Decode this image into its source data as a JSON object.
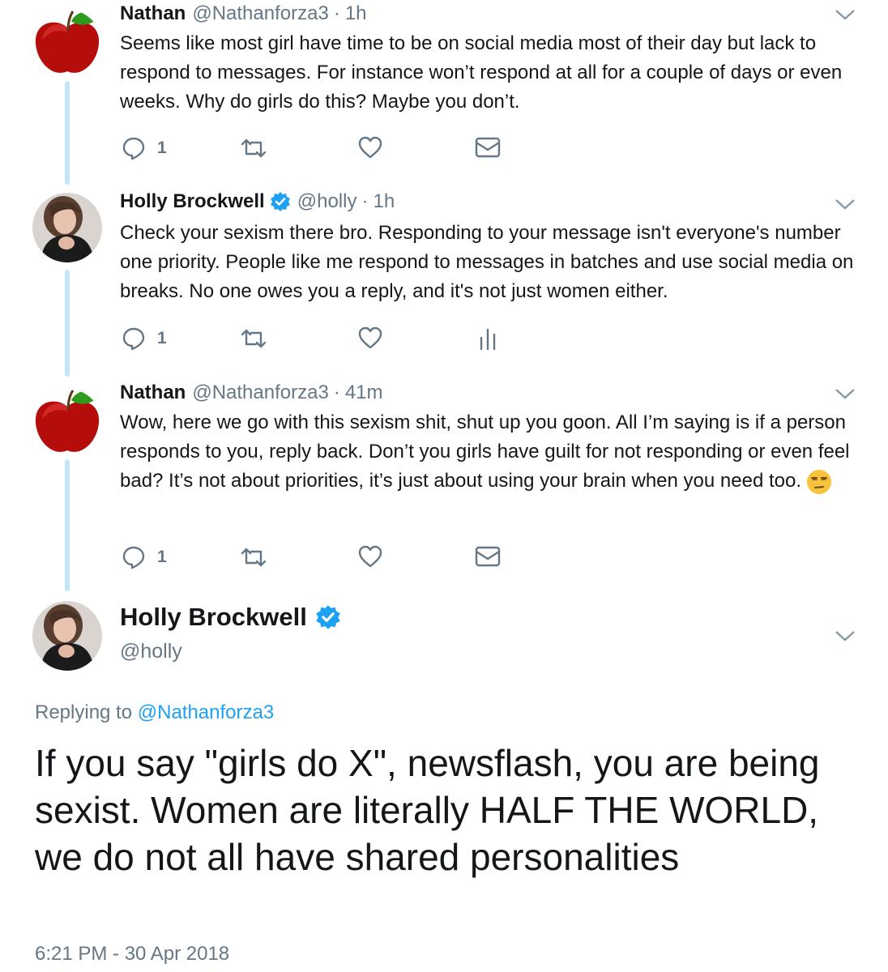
{
  "thread": [
    {
      "author": "Nathan",
      "handle": "@Nathanforza3",
      "time": "1h",
      "avatar_icon": "apple-icon",
      "verified": false,
      "text": "Seems like most girl have time to be on social media most of their day but lack to respond to messages. For instance won’t respond at all for a couple of days or even weeks. Why do girls do this? Maybe you don’t.",
      "reply_count": "1",
      "last_action_icon": "dm-envelope-icon"
    },
    {
      "author": "Holly Brockwell",
      "handle": "@holly",
      "time": "1h",
      "avatar_icon": "profile-photo",
      "verified": true,
      "text": "Check your sexism there bro. Responding to your message isn't everyone's number one priority. People like me respond to messages in batches and use social media on breaks. No one owes you a reply, and it's not just women either.",
      "reply_count": "1",
      "last_action_icon": "analytics-icon"
    },
    {
      "author": "Nathan",
      "handle": "@Nathanforza3",
      "time": "41m",
      "avatar_icon": "apple-icon",
      "verified": false,
      "text": "Wow, here we go with this sexism shit, shut up you goon. All I’m saying is if a person responds to you, reply back. Don’t you girls have guilt for not responding or even feel bad? It’s not about priorities, it’s just about using your brain when you need too.",
      "emoji": "unamused-face-emoji",
      "reply_count": "1",
      "last_action_icon": "dm-envelope-icon"
    }
  ],
  "main_tweet": {
    "author": "Holly Brockwell",
    "handle": "@holly",
    "verified": true,
    "replying_prefix": "Replying to",
    "replying_to": "@Nathanforza3",
    "text": "If you say \"girls do X\", newsflash, you are being sexist. Women are literally HALF THE WORLD, we do not all have shared personalities",
    "timestamp": "6:21 PM - 30 Apr 2018"
  },
  "colors": {
    "text": "#14171a",
    "secondary": "#657786",
    "link": "#1da1f2",
    "thread_line": "#c4e6f7",
    "verified": "#1da1f2"
  }
}
